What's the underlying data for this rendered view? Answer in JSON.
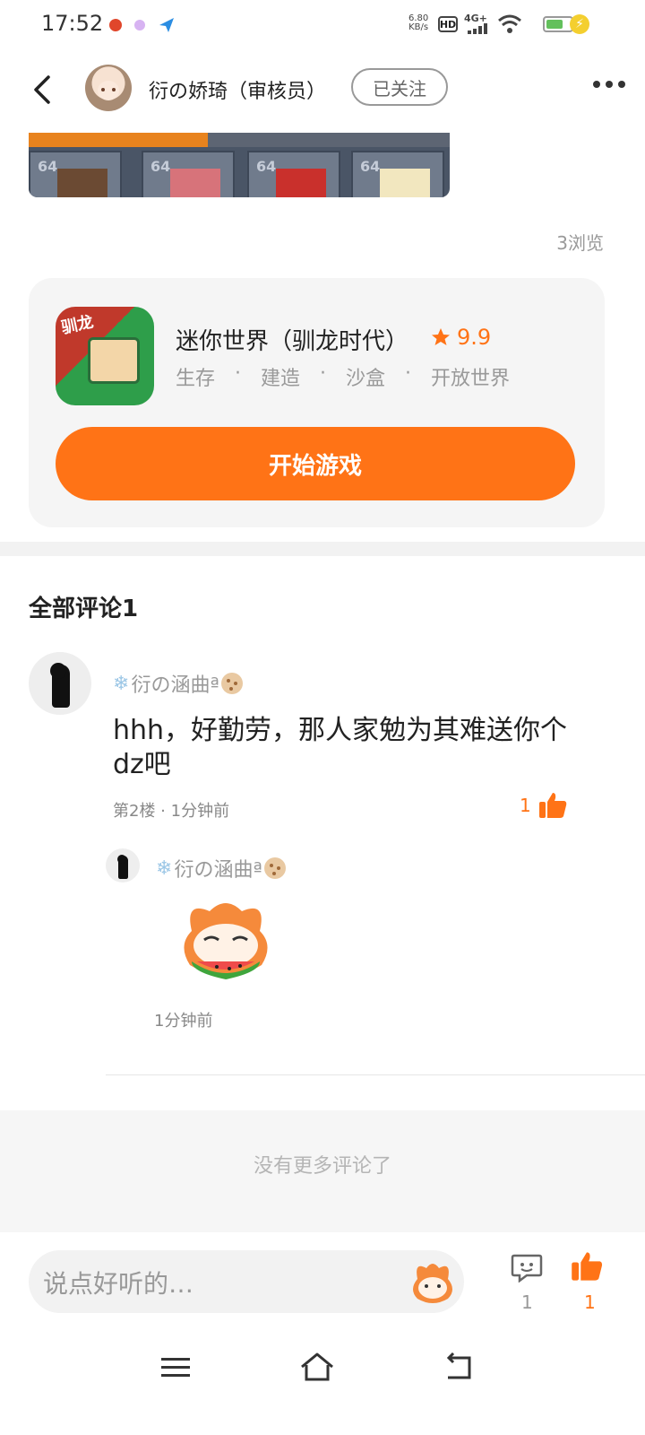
{
  "status_bar": {
    "time": "17:52",
    "net_speed_value": "6.80",
    "net_speed_unit": "KB/s",
    "hd": "HD",
    "network": "4G+",
    "icons": [
      "tomato-notification-icon",
      "petal-notification-icon",
      "paper-plane-notification-icon",
      "wifi-icon",
      "battery-icon",
      "charging-icon"
    ]
  },
  "header": {
    "author_name": "衍の娇琦（审核员）",
    "follow_label": "已关注"
  },
  "post": {
    "views": "3浏览",
    "image_slot_count_labels": [
      "64",
      "64",
      "64",
      "64"
    ]
  },
  "game": {
    "title": "迷你世界（驯龙时代）",
    "rating": "9.9",
    "tags": [
      "生存",
      "建造",
      "沙盒",
      "开放世界"
    ],
    "tag_separator": "·",
    "icon_text": "驯龙",
    "play_label": "开始游戏"
  },
  "comments": {
    "heading": "全部评论1",
    "items": [
      {
        "user": "衍の涵曲ª",
        "text": "hhh，好勤劳，那人家勉为其难送你个dz吧",
        "meta": "第2楼 · 1分钟前",
        "likes": "1",
        "reply": {
          "user": "衍の涵曲ª",
          "meta": "1分钟前"
        }
      }
    ],
    "no_more": "没有更多评论了"
  },
  "bottom_bar": {
    "placeholder": "说点好听的…",
    "comment_count": "1",
    "like_count": "1"
  },
  "colors": {
    "accent": "#ff7316",
    "card_bg": "#f5f5f5",
    "muted_text": "#999999"
  }
}
